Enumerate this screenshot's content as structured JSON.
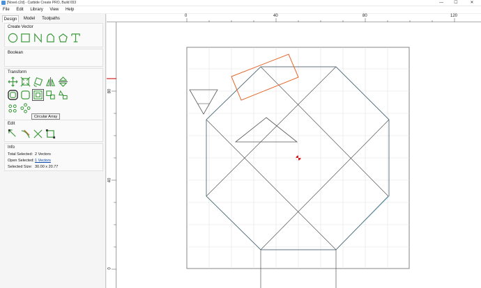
{
  "window": {
    "title": "[Novel.c2d] - Carbide Create PRO, Build 653",
    "min_glyph": "—",
    "max_glyph": "☐",
    "close_glyph": "✕"
  },
  "menu": {
    "file": "File",
    "edit": "Edit",
    "library": "Library",
    "view": "View",
    "help": "Help"
  },
  "tabs": {
    "design": "Design",
    "model": "Model",
    "toolpaths": "Toolpaths"
  },
  "sections": {
    "create_vector": "Create Vector",
    "boolean": "Boolean",
    "transform": "Transform",
    "edit": "Edit",
    "info": "Info"
  },
  "icons": {
    "create_vector": [
      "circle-icon",
      "rectangle-icon",
      "polyline-icon",
      "curve-icon",
      "polygon-icon",
      "text-icon"
    ],
    "transform": [
      "move-icon",
      "scale-icon",
      "rotate-icon",
      "mirror-icon",
      "flip-icon",
      "offset-icon",
      "fillet-icon",
      "inset-icon",
      "align-icon",
      "distribute-icon",
      "linear-array-icon",
      "circular-array-icon"
    ],
    "edit": [
      "node-edit-icon",
      "trim-icon",
      "cut-icon",
      "bounding-box-icon"
    ]
  },
  "tooltip": "Circular Array",
  "info": {
    "total_selected_label": "Total Selected:",
    "total_selected_value": "2 Vectors",
    "open_selected_label": "Open Selected:",
    "open_selected_value": "1 Vectors",
    "selected_size_label": "Selected Size:",
    "selected_size_value": "30.00 x 20.77"
  },
  "ruler": {
    "top_labels": [
      "0",
      "40",
      "80",
      "120"
    ],
    "left_labels": [
      "80",
      "40",
      "0"
    ]
  },
  "colors": {
    "accent_green": "#3c9a3c",
    "selection_orange": "#e5672a",
    "preview_cyan": "#7fd0ee",
    "vector_gray": "#555555",
    "origin_red": "#d42020"
  }
}
